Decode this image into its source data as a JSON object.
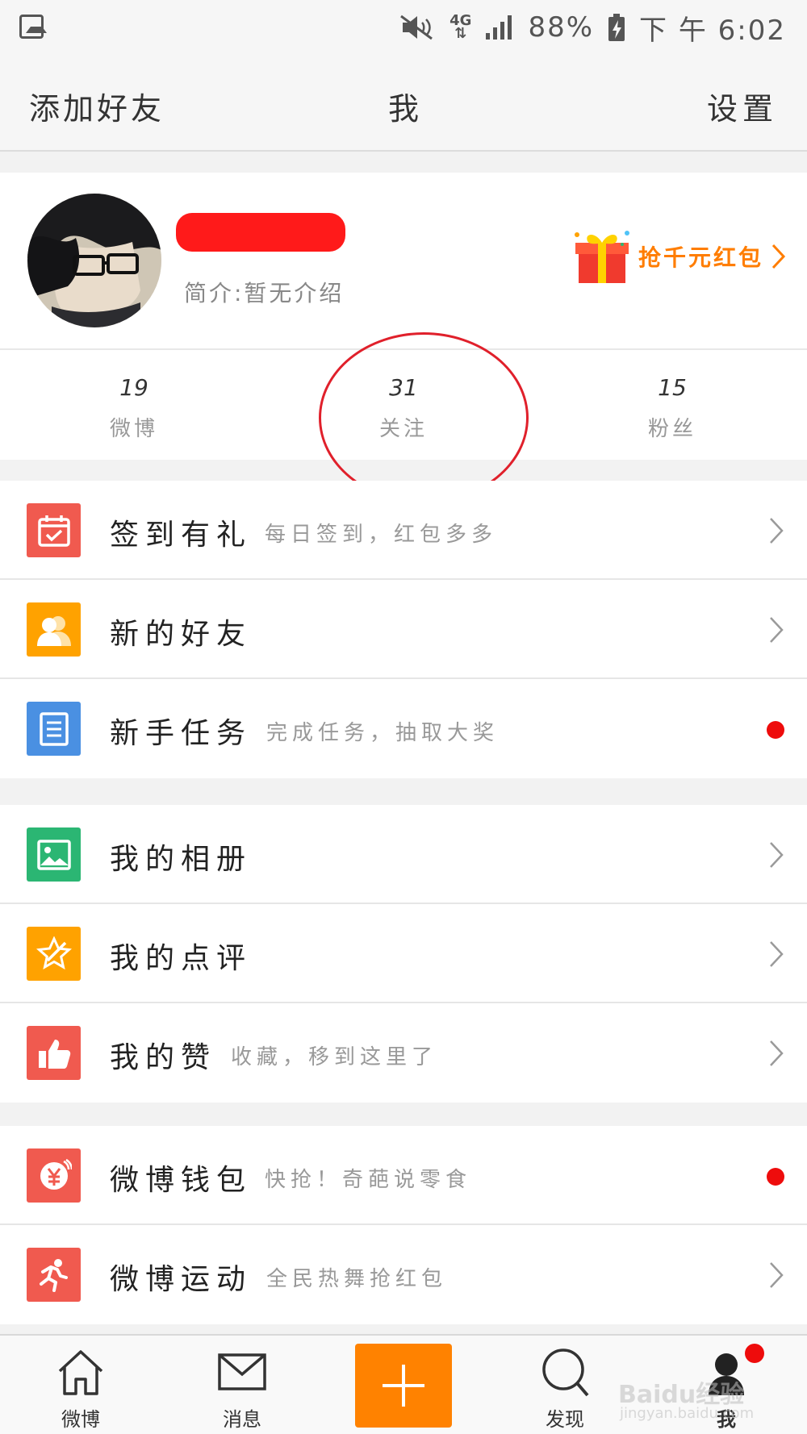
{
  "status_bar": {
    "network": "4G",
    "battery": "88%",
    "time": "下 午 6:02"
  },
  "nav": {
    "left": "添加好友",
    "title": "我",
    "right": "设置"
  },
  "profile": {
    "bio": "简介:暂无介绍",
    "redpacket_label": "抢千元红包"
  },
  "stats": [
    {
      "num": "19",
      "label": "微博"
    },
    {
      "num": "31",
      "label": "关注"
    },
    {
      "num": "15",
      "label": "粉丝"
    }
  ],
  "group1": [
    {
      "title": "签到有礼",
      "sub": "每日签到，红包多多",
      "icon": "calendar-check-icon",
      "color": "#f05a4f",
      "end": "chevron"
    },
    {
      "title": "新的好友",
      "sub": "",
      "icon": "friends-icon",
      "color": "#ffa200",
      "end": "chevron"
    },
    {
      "title": "新手任务",
      "sub": "完成任务，抽取大奖",
      "icon": "task-list-icon",
      "color": "#4a90e2",
      "end": "dot"
    }
  ],
  "group2": [
    {
      "title": "我的相册",
      "sub": "",
      "icon": "photo-album-icon",
      "color": "#2bb673",
      "end": "chevron"
    },
    {
      "title": "我的点评",
      "sub": "",
      "icon": "star-review-icon",
      "color": "#ffa200",
      "end": "chevron"
    },
    {
      "title": "我的赞",
      "sub": "收藏，移到这里了",
      "icon": "thumbs-up-icon",
      "color": "#f05a4f",
      "end": "chevron"
    }
  ],
  "group3": [
    {
      "title": "微博钱包",
      "sub": "快抢！奇葩说零食",
      "icon": "wallet-yen-icon",
      "color": "#f05a4f",
      "end": "dot"
    },
    {
      "title": "微博运动",
      "sub": "全民热舞抢红包",
      "icon": "running-icon",
      "color": "#f05a4f",
      "end": "chevron"
    }
  ],
  "tabs": [
    {
      "label": "微博",
      "icon": "home-icon"
    },
    {
      "label": "消息",
      "icon": "mail-icon"
    },
    {
      "label": "发现",
      "icon": "search-icon"
    },
    {
      "label": "我",
      "icon": "profile-icon"
    }
  ],
  "watermark": {
    "main": "Baidu经验",
    "sub": "jingyan.baidu.com"
  },
  "colors": {
    "accent_orange": "#ff8200",
    "red_dot": "#ee0c0c"
  }
}
